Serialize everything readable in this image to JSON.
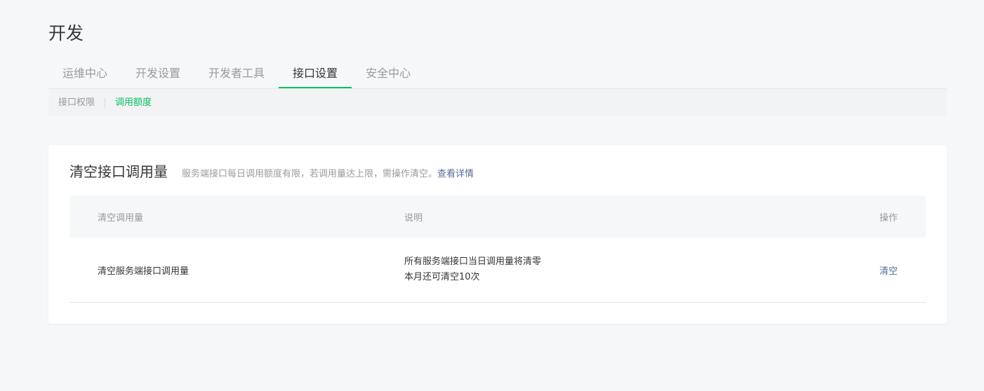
{
  "page": {
    "title": "开发"
  },
  "tabs": [
    {
      "label": "运维中心",
      "active": false
    },
    {
      "label": "开发设置",
      "active": false
    },
    {
      "label": "开发者工具",
      "active": false
    },
    {
      "label": "接口设置",
      "active": true
    },
    {
      "label": "安全中心",
      "active": false
    }
  ],
  "subnav": [
    {
      "label": "接口权限",
      "active": false
    },
    {
      "label": "调用额度",
      "active": true
    }
  ],
  "card": {
    "title": "清空接口调用量",
    "description": "服务端接口每日调用额度有限，若调用量达上限，需操作清空。",
    "link_label": "查看详情"
  },
  "table": {
    "headers": [
      "清空调用量",
      "说明",
      "操作"
    ],
    "rows": [
      {
        "name": "清空服务端接口调用量",
        "description_lines": [
          "所有服务端接口当日调用量将清零",
          "本月还可清空10次"
        ],
        "action": "清空"
      }
    ]
  },
  "colors": {
    "accent": "#07c160",
    "link": "#576b95",
    "text": "#353535",
    "muted": "#9a9a9a",
    "background": "#f6f7f9"
  }
}
